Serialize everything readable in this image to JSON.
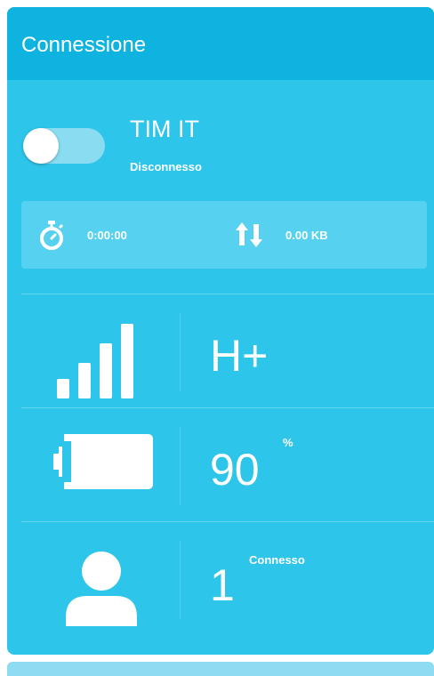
{
  "header": {
    "title": "Connessione"
  },
  "connection": {
    "toggle_on": false,
    "network_name": "TIM IT",
    "status": "Disconnesso"
  },
  "stats": {
    "duration_icon": "stopwatch-icon",
    "duration": "0:00:00",
    "traffic_icon": "up-down-arrows-icon",
    "traffic": "0.00 KB"
  },
  "signal": {
    "icon": "signal-bars-icon",
    "network_type": "H+"
  },
  "battery": {
    "icon": "battery-icon",
    "level": "90",
    "unit": "%",
    "level_fraction": 0.9
  },
  "clients": {
    "icon": "user-icon",
    "count": "1",
    "label": "Connesso"
  },
  "colors": {
    "header_bg": "#0fb3e0",
    "card_bg": "#2ec5ea",
    "stats_bg": "#56d1ef",
    "text": "#ffffff"
  }
}
